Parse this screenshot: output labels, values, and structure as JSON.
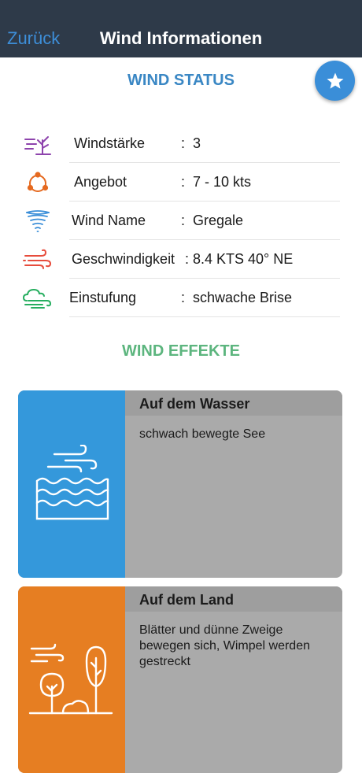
{
  "nav": {
    "back": "Zurück",
    "title": "Wind Informationen"
  },
  "status": {
    "title": "WIND STATUS",
    "rows": [
      {
        "icon": "tree-wind-icon",
        "label": "Windstärke",
        "colon": ":",
        "value": "3"
      },
      {
        "icon": "cycle-icon",
        "label": "Angebot",
        "colon": ":",
        "value": "7 - 10  kts"
      },
      {
        "icon": "tornado-icon",
        "label": "Wind Name",
        "colon": ":",
        "value": "Gregale"
      },
      {
        "icon": "wind-speed-icon",
        "label": "Geschwindigkeit",
        "colon": ":",
        "value": "8.4 KTS 40° NE"
      },
      {
        "icon": "cloud-wind-icon",
        "label": "Einstufung",
        "colon": ":",
        "value": "schwache Brise"
      }
    ]
  },
  "effects": {
    "title": "WIND EFFEKTE",
    "water": {
      "heading": "Auf dem Wasser",
      "text": "schwach bewegte See"
    },
    "land": {
      "heading": "Auf dem Land",
      "text": "Blätter und dünne Zweige bewegen sich, Wimpel werden gestreckt"
    }
  },
  "colors": {
    "navbar": "#2e3a49",
    "accent_blue": "#3a8ed8",
    "status_title": "#3a87c4",
    "effects_title": "#5cb57e",
    "water_card": "#3498db",
    "land_card": "#e67e22"
  }
}
